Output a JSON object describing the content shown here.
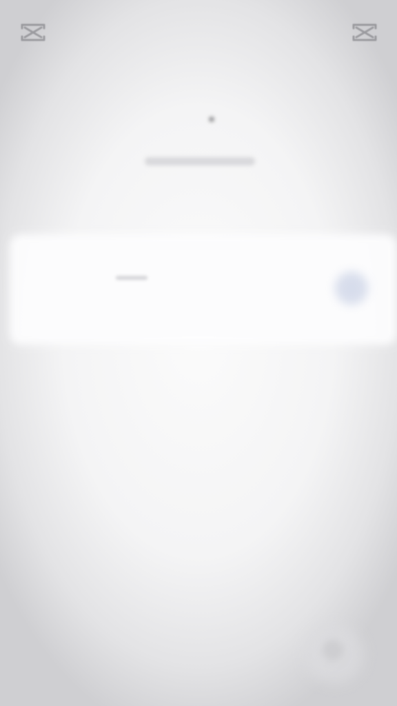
{
  "header": {
    "left_icon": "capcut-logo-icon",
    "right_icon": "capcut-logo-icon"
  },
  "heading": {
    "title": "",
    "subtitle": ""
  },
  "card": {
    "primary_text": "",
    "secondary_text": "",
    "action_icon": "circle-action-icon"
  },
  "fab": {
    "icon": "floating-action-icon"
  },
  "colors": {
    "background_center": "#fbfbfb",
    "background_edge": "#cfcfd2",
    "card": "#fdfdfe",
    "accent": "#cfd6e8"
  }
}
